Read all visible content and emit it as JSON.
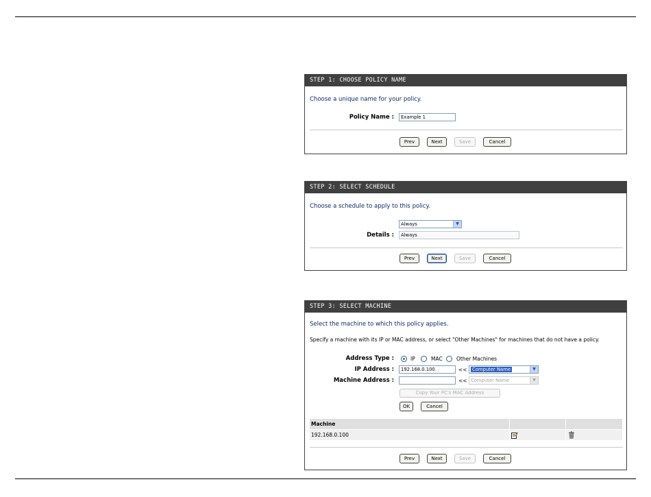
{
  "step1": {
    "title": "STEP 1: CHOOSE POLICY NAME",
    "intro": "Choose a unique name for your policy.",
    "policy_name_label": "Policy Name :",
    "policy_name_value": "Example 1",
    "buttons": {
      "prev": "Prev",
      "next": "Next",
      "save": "Save",
      "cancel": "Cancel"
    }
  },
  "step2": {
    "title": "STEP 2: SELECT SCHEDULE",
    "intro": "Choose a schedule to apply to this policy.",
    "schedule_selected": "Always",
    "details_label": "Details :",
    "details_value": "Always",
    "buttons": {
      "prev": "Prev",
      "next": "Next",
      "save": "Save",
      "cancel": "Cancel"
    }
  },
  "step3": {
    "title": "STEP 3: SELECT MACHINE",
    "intro": "Select the machine to which this policy applies.",
    "description": "Specify a machine with its IP or MAC address, or select \"Other Machines\" for machines that do not have a policy.",
    "address_type_label": "Address Type :",
    "address_types": [
      "IP",
      "MAC",
      "Other Machines"
    ],
    "address_type_selected": "IP",
    "ip_label": "IP Address :",
    "ip_value": "192.168.0.100",
    "ip_arrows": "<<",
    "ip_computer_select": "Computer Name",
    "machine_address_label": "Machine Address :",
    "machine_address_value": "",
    "mac_arrows": "<<",
    "mac_computer_select": "Computer Name",
    "copy_mac_button": "Copy Your PC's MAC Address",
    "ok_button": "OK",
    "cancel_button": "Cancel",
    "table": {
      "header": "Machine",
      "rows": [
        {
          "machine": "192.168.0.100"
        }
      ]
    },
    "buttons": {
      "prev": "Prev",
      "next": "Next",
      "save": "Save",
      "cancel": "Cancel"
    }
  },
  "icons": {
    "edit": "edit-icon",
    "delete": "trash-icon"
  }
}
